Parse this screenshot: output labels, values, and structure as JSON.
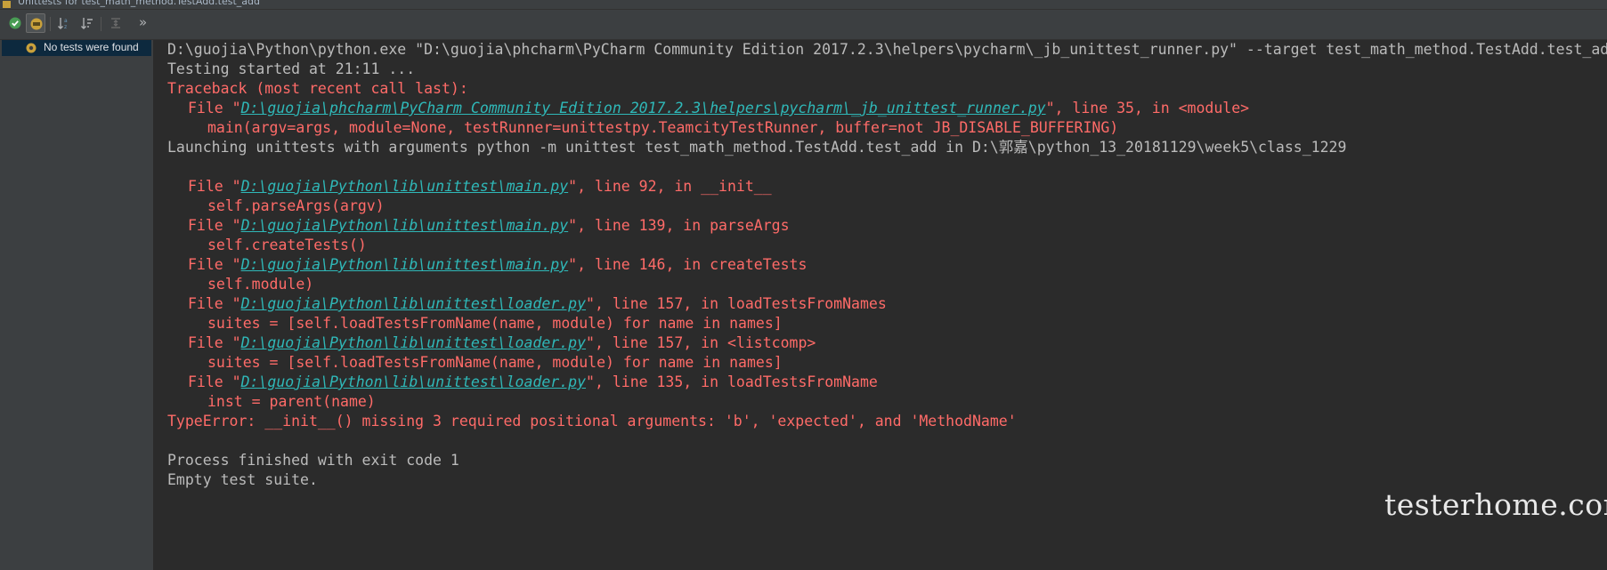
{
  "window": {
    "title": "Unittests for test_math_method.TestAdd.test_add"
  },
  "toolbar": {
    "buttons": [
      {
        "name": "show-passed-icon"
      },
      {
        "name": "show-ignored-icon"
      },
      {
        "name": "sort-alphabetically-icon"
      },
      {
        "name": "sort-by-duration-icon"
      },
      {
        "name": "expand-all-icon"
      },
      {
        "name": "more-icon",
        "glyph": "»"
      }
    ]
  },
  "tree": {
    "status": "No tests were found"
  },
  "console": {
    "l1": "D:\\guojia\\Python\\python.exe \"D:\\guojia\\phcharm\\PyCharm Community Edition 2017.2.3\\helpers\\pycharm\\_jb_unittest_runner.py\" --target test_math_method.TestAdd.test_add",
    "l2": "Testing started at 21:11 ...",
    "l3": "Traceback (most recent call last):",
    "l4a": "File \"",
    "l4link": "D:\\guojia\\phcharm\\PyCharm Community Edition 2017.2.3\\helpers\\pycharm\\_jb_unittest_runner.py",
    "l4b": "\", line 35, in <module>",
    "l5": "main(argv=args, module=None, testRunner=unittestpy.TeamcityTestRunner, buffer=not JB_DISABLE_BUFFERING)",
    "l6": "Launching unittests with arguments python -m unittest test_math_method.TestAdd.test_add in D:\\郭嘉\\python_13_20181129\\week5\\class_1229",
    "file_prefix": "File \"",
    "frames": [
      {
        "path": "D:\\guojia\\Python\\lib\\unittest\\main.py",
        "tail": "\", line 92, in __init__",
        "code": "self.parseArgs(argv)"
      },
      {
        "path": "D:\\guojia\\Python\\lib\\unittest\\main.py",
        "tail": "\", line 139, in parseArgs",
        "code": "self.createTests()"
      },
      {
        "path": "D:\\guojia\\Python\\lib\\unittest\\main.py",
        "tail": "\", line 146, in createTests",
        "code": "self.module)"
      },
      {
        "path": "D:\\guojia\\Python\\lib\\unittest\\loader.py",
        "tail": "\", line 157, in loadTestsFromNames",
        "code": "suites = [self.loadTestsFromName(name, module) for name in names]"
      },
      {
        "path": "D:\\guojia\\Python\\lib\\unittest\\loader.py",
        "tail": "\", line 157, in <listcomp>",
        "code": "suites = [self.loadTestsFromName(name, module) for name in names]"
      },
      {
        "path": "D:\\guojia\\Python\\lib\\unittest\\loader.py",
        "tail": "\", line 135, in loadTestsFromName",
        "code": "inst = parent(name)"
      }
    ],
    "error": "TypeError: __init__() missing 3 required positional arguments: 'b', 'expected', and 'MethodName'",
    "process": "Process finished with exit code 1",
    "empty": "Empty test suite."
  },
  "watermark": "testerhome.com",
  "colors": {
    "red": "#ff6b68",
    "link": "#2fb8b8",
    "text": "#bbbbbb",
    "bg": "#2b2b2b",
    "panel": "#3c3f41",
    "selection": "#0d293e"
  }
}
